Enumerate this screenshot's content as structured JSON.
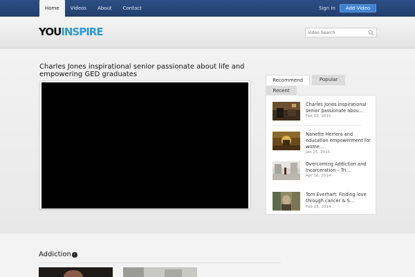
{
  "nav": {
    "items": [
      "Home",
      "Videos",
      "About",
      "Contact"
    ],
    "active": "Home",
    "sign_in": "Sign In",
    "add_video": "Add Video"
  },
  "header": {
    "logo_part1": "YOU",
    "logo_part2": "INSPIRE",
    "search_placeholder": "Video Search"
  },
  "video": {
    "title": "Charles Jones inspirational senior passionate about life and empowering GED graduates"
  },
  "sidebar": {
    "tabs": [
      "Recommend",
      "Popular",
      "Recent"
    ],
    "active_tab": "Recommend",
    "items": [
      {
        "title": "Charles Jones inspirational senior passionate abou…",
        "date": "Feb 03, 2015"
      },
      {
        "title": "Nanette Herrera and education empowerment for wome…",
        "date": "Jan 25, 2015"
      },
      {
        "title": "Overcoming Addiction and Incarceration – Tri…",
        "date": "Apr 18, 2014"
      },
      {
        "title": "Tom Everhart: Finding love through cancer & S…",
        "date": "Feb 25, 2014"
      }
    ]
  },
  "section": {
    "title": "Addiction",
    "arrow": "›"
  },
  "colors": {
    "nav_bg": "#2d4f86",
    "accent_button": "#3f82d4",
    "logo_accent": "#2e9bd0"
  }
}
